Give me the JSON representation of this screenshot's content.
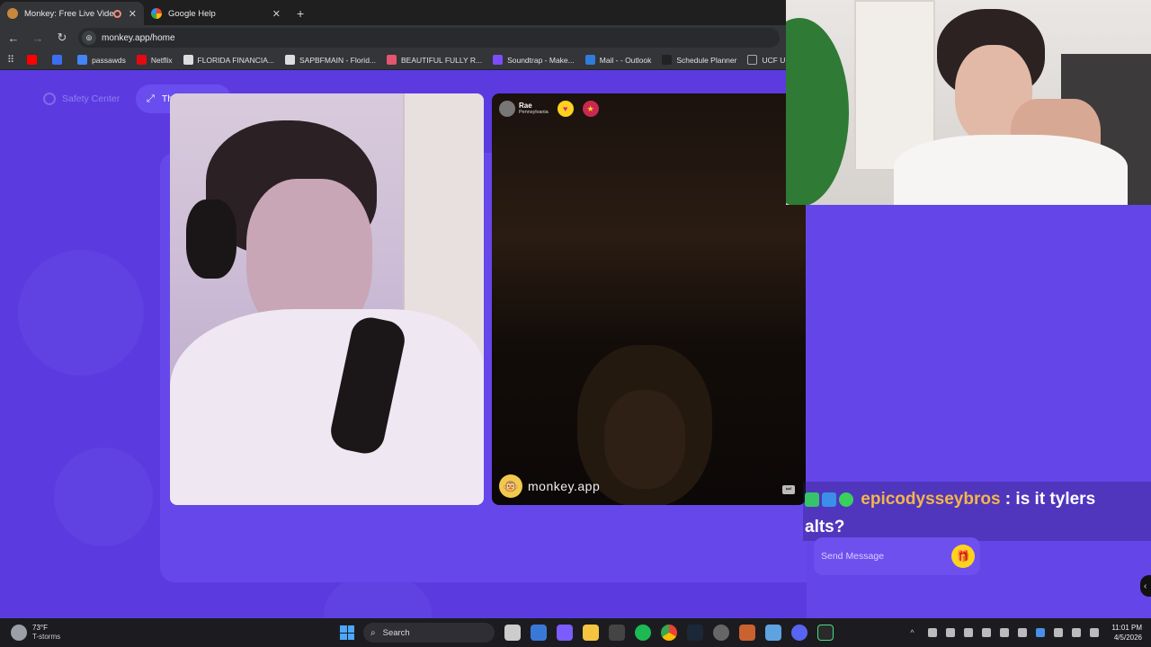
{
  "browser": {
    "tabs": [
      {
        "title": "Monkey: Free Live Video Ch",
        "active": true,
        "recording": true
      },
      {
        "title": "Google Help",
        "active": false
      }
    ],
    "new_tab": "+",
    "url": "monkey.app/home",
    "bookmarks": [
      {
        "label": "",
        "color": "#ff0000"
      },
      {
        "label": "",
        "color": "#3c6ff0"
      },
      {
        "label": "passawds",
        "color": "#4285f4"
      },
      {
        "label": "Netflix",
        "color": "#e50914"
      },
      {
        "label": "FLORIDA FINANCIA...",
        "color": "#dddddd"
      },
      {
        "label": "SAPBFMAIN - Florid...",
        "color": "#dddddd"
      },
      {
        "label": "BEAUTIFUL FULLY R...",
        "color": "#e3566f"
      },
      {
        "label": "Soundtrap - Make...",
        "color": "#7c4dff"
      },
      {
        "label": "Mail - - Outlook",
        "color": "#2f7ddb"
      },
      {
        "label": "Schedule Planner",
        "color": "#222222"
      },
      {
        "label": "UCF USEFUL LINKS",
        "color": "#888888"
      }
    ]
  },
  "page": {
    "safety_center": "Safety Center",
    "theater_mode": "Theater Mode",
    "partner": {
      "name": "Rae",
      "location": "Pennsylvania"
    },
    "watermark": "monkey.app",
    "chat": {
      "username": "epicodysseybros",
      "separator": " : ",
      "message_part1": "is it tylers",
      "message_part2": "alts?",
      "send_placeholder": "Send Message"
    },
    "accent": "#5b3be0"
  },
  "taskbar": {
    "temperature": "73°F",
    "condition": "T-storms",
    "search": "Search",
    "time": "11:01 PM",
    "date": "4/5/2026"
  }
}
